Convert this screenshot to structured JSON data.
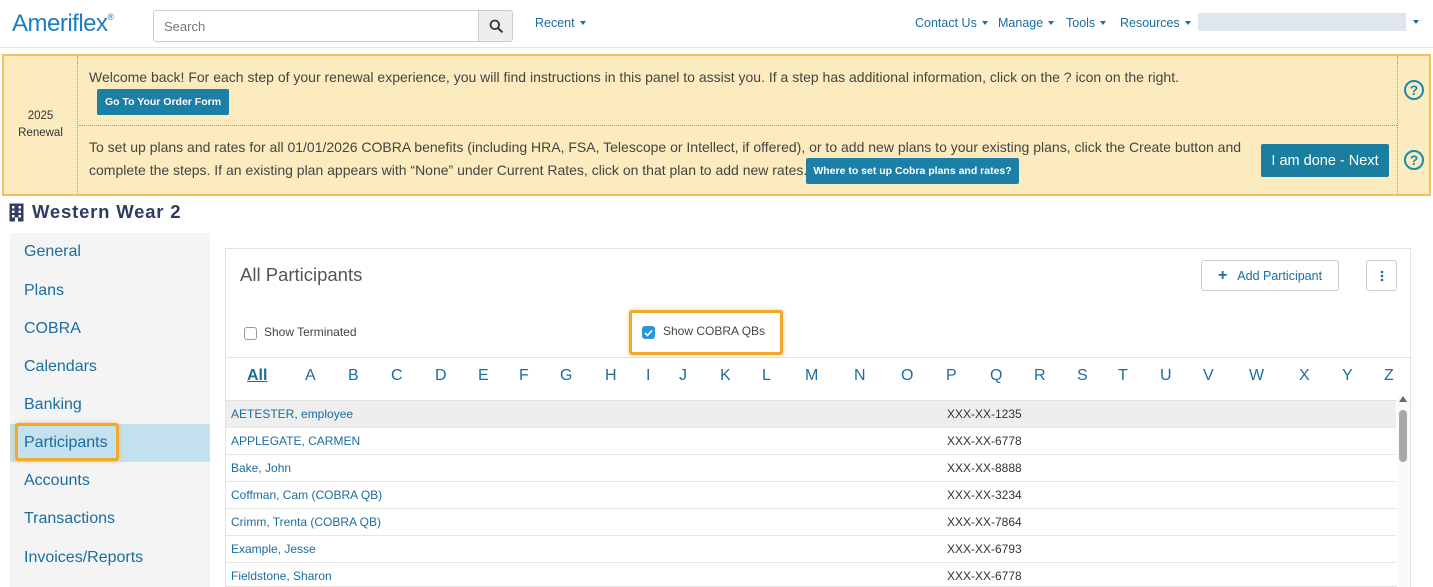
{
  "header": {
    "logo_text": "Ameriflex",
    "logo_reg": "®",
    "search_placeholder": "Search",
    "search_icon": "search-icon",
    "nav": {
      "recent": "Recent",
      "contact_us": "Contact Us",
      "manage": "Manage",
      "tools": "Tools",
      "resources": "Resources"
    }
  },
  "renewal": {
    "side_year": "2025",
    "side_label": "Renewal",
    "welcome_text": "Welcome back! For each step of your renewal experience, you will find instructions in this panel to assist you. If a step has additional information, click on the ? icon on the right.",
    "order_form_button": "Go To Your Order Form",
    "step_text_line1": "To set up plans and rates for all 01/01/2026 COBRA benefits (including HRA, FSA, Telescope or Intellect, if offered), or to add new plans to your existing plans, click the Create button and",
    "step_text_line2": "complete the steps. If an existing plan appears with “None” under Current Rates, click on that plan to add new rates.",
    "cobra_help_button": "Where to set up Cobra plans and rates?",
    "next_button": "I am done - Next",
    "help_glyph": "?"
  },
  "company": {
    "name": "Western Wear 2",
    "icon": "building-icon"
  },
  "sidebar": {
    "items": [
      {
        "label": "General"
      },
      {
        "label": "Plans"
      },
      {
        "label": "COBRA"
      },
      {
        "label": "Calendars"
      },
      {
        "label": "Banking"
      },
      {
        "label": "Participants",
        "active": true
      },
      {
        "label": "Accounts"
      },
      {
        "label": "Transactions"
      },
      {
        "label": "Invoices/Reports"
      }
    ]
  },
  "main": {
    "title": "All Participants",
    "add_button": "Add Participant",
    "show_terminated": {
      "label": "Show Terminated",
      "checked": false
    },
    "show_cobra_qbs": {
      "label": "Show COBRA QBs",
      "checked": true
    },
    "alphabet": [
      "All",
      "A",
      "B",
      "C",
      "D",
      "E",
      "F",
      "G",
      "H",
      "I",
      "J",
      "K",
      "L",
      "M",
      "N",
      "O",
      "P",
      "Q",
      "R",
      "S",
      "T",
      "U",
      "V",
      "W",
      "X",
      "Y",
      "Z"
    ],
    "participants": [
      {
        "name": "AETESTER, employee",
        "ssn": "XXX-XX-1235"
      },
      {
        "name": "APPLEGATE, CARMEN",
        "ssn": "XXX-XX-6778"
      },
      {
        "name": "Bake, John",
        "ssn": "XXX-XX-8888"
      },
      {
        "name": "Coffman, Cam (COBRA QB)",
        "ssn": "XXX-XX-3234"
      },
      {
        "name": "Crimm, Trenta (COBRA QB)",
        "ssn": "XXX-XX-7864"
      },
      {
        "name": "Example, Jesse",
        "ssn": "XXX-XX-6793"
      },
      {
        "name": "Fieldstone, Sharon",
        "ssn": "XXX-XX-6778"
      }
    ]
  },
  "colors": {
    "link": "#1b6d9e",
    "teal_button": "#1c7fa6",
    "renewal_bg": "#fcebbf",
    "highlight": "#f1a92d",
    "active_sidebar": "#c3e1ee"
  }
}
